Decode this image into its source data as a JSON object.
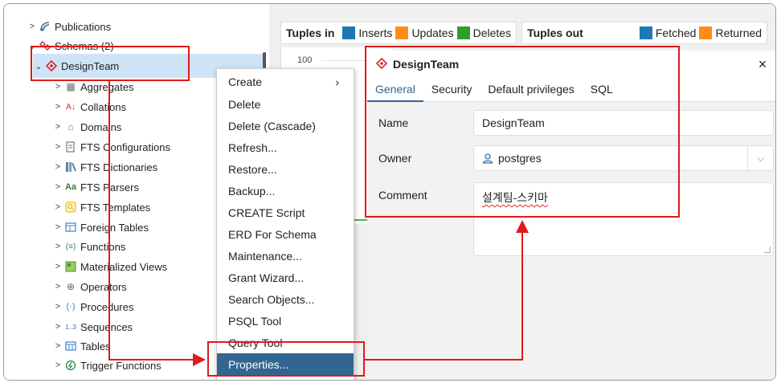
{
  "tree": {
    "items": [
      {
        "label": "Publications",
        "icon": "publications-icon",
        "expanded": false
      },
      {
        "label": "Schemas (2)",
        "icon": "schemas-icon",
        "expanded": true
      },
      {
        "label": "DesignTeam",
        "icon": "schema-icon",
        "expanded": true,
        "selected": true
      },
      {
        "label": "Aggregates",
        "icon": "aggregates-icon"
      },
      {
        "label": "Collations",
        "icon": "collations-icon"
      },
      {
        "label": "Domains",
        "icon": "domains-icon"
      },
      {
        "label": "FTS Configurations",
        "icon": "fts-configurations-icon"
      },
      {
        "label": "FTS Dictionaries",
        "icon": "fts-dictionaries-icon"
      },
      {
        "label": "FTS Parsers",
        "icon": "fts-parsers-icon"
      },
      {
        "label": "FTS Templates",
        "icon": "fts-templates-icon"
      },
      {
        "label": "Foreign Tables",
        "icon": "foreign-tables-icon"
      },
      {
        "label": "Functions",
        "icon": "functions-icon"
      },
      {
        "label": "Materialized Views",
        "icon": "materialized-views-icon"
      },
      {
        "label": "Operators",
        "icon": "operators-icon"
      },
      {
        "label": "Procedures",
        "icon": "procedures-icon"
      },
      {
        "label": "Sequences",
        "icon": "sequences-icon"
      },
      {
        "label": "Tables",
        "icon": "tables-icon"
      },
      {
        "label": "Trigger Functions",
        "icon": "trigger-functions-icon"
      }
    ],
    "icon_glyphs": {
      "aggregates": "▦",
      "collations": "A↓",
      "domains": "⌂",
      "fts_text": "Aa",
      "functions": "(≡)",
      "operators": "⊕",
      "procedures": "(·)",
      "sequences": "1..3"
    }
  },
  "stats": {
    "tuples_in": {
      "title": "Tuples in",
      "legend": [
        {
          "label": "Inserts",
          "color": "#1f77b4"
        },
        {
          "label": "Updates",
          "color": "#ff8c1a"
        },
        {
          "label": "Deletes",
          "color": "#2ca02c"
        }
      ]
    },
    "tuples_out": {
      "title": "Tuples out",
      "legend": [
        {
          "label": "Fetched",
          "color": "#1f77b4"
        },
        {
          "label": "Returned",
          "color": "#ff8c1a"
        }
      ]
    },
    "y_tick": "100"
  },
  "context_menu": {
    "items": [
      {
        "label": "Create",
        "submenu": true
      },
      {
        "label": "Delete"
      },
      {
        "label": "Delete (Cascade)"
      },
      {
        "label": "Refresh..."
      },
      {
        "label": "Restore..."
      },
      {
        "label": "Backup..."
      },
      {
        "label": "CREATE Script"
      },
      {
        "label": "ERD For Schema"
      },
      {
        "label": "Maintenance..."
      },
      {
        "label": "Grant Wizard..."
      },
      {
        "label": "Search Objects..."
      },
      {
        "label": "PSQL Tool"
      },
      {
        "label": "Query Tool"
      },
      {
        "label": "Properties...",
        "active": true
      }
    ],
    "submenu_arrow": "›"
  },
  "dialog": {
    "title": "DesignTeam",
    "close": "×",
    "tabs": [
      "General",
      "Security",
      "Default privileges",
      "SQL"
    ],
    "active_tab": "General",
    "fields": {
      "name_label": "Name",
      "name_value": "DesignTeam",
      "owner_label": "Owner",
      "owner_value": "postgres",
      "comment_label": "Comment",
      "comment_value": "설계팀-스키마"
    }
  },
  "colors": {
    "accent": "#326690",
    "annotation": "#e01919",
    "selection": "#cfe3f7",
    "schema_icon": "#d9262b"
  }
}
